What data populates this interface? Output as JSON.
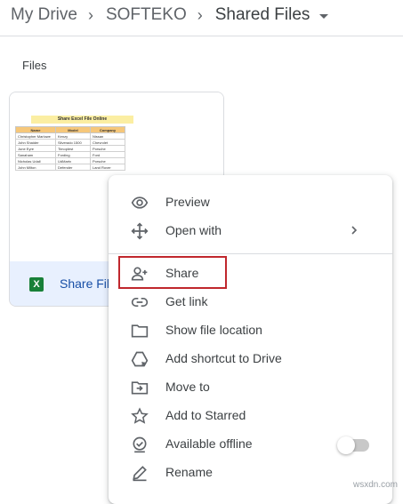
{
  "breadcrumb": {
    "root": "My Drive",
    "folder": "SOFTEKO",
    "current": "Shared Files",
    "separator": "›"
  },
  "section": {
    "label": "Files"
  },
  "file": {
    "name": "Share File",
    "type_icon_letter": "X",
    "thumbnail": {
      "title": "Share Excel File Online",
      "headers": [
        "Name",
        "Model",
        "Company"
      ],
      "rows": [
        [
          "Christopher Marlowe",
          "Kenzy",
          "Nissan"
        ],
        [
          "John Shaider",
          "Silverado 1500",
          "Chevrolet"
        ],
        [
          "June Eyre",
          "Timoplest",
          "Porsche"
        ],
        [
          "Sanaham",
          "Fording",
          "Ford"
        ],
        [
          "Nicholas Udall",
          "UdMartx",
          "Porsche"
        ],
        [
          "John Milton",
          "Defender",
          "Land Rover"
        ]
      ]
    }
  },
  "context_menu": {
    "items": [
      {
        "label": "Preview",
        "icon": "eye-icon"
      },
      {
        "label": "Open with",
        "icon": "move-arrows-icon",
        "has_submenu": true
      },
      {
        "label": "Share",
        "icon": "person-add-icon",
        "highlighted": true
      },
      {
        "label": "Get link",
        "icon": "link-icon"
      },
      {
        "label": "Show file location",
        "icon": "folder-icon"
      },
      {
        "label": "Add shortcut to Drive",
        "icon": "drive-shortcut-icon"
      },
      {
        "label": "Move to",
        "icon": "move-to-folder-icon"
      },
      {
        "label": "Add to Starred",
        "icon": "star-icon"
      },
      {
        "label": "Available offline",
        "icon": "offline-check-icon",
        "toggle": false
      },
      {
        "label": "Rename",
        "icon": "pencil-icon"
      }
    ]
  },
  "watermark": "wsxdn.com",
  "colors": {
    "highlight_border": "#c0272d",
    "card_footer": "#e8f0fe",
    "excel_green": "#188038"
  }
}
